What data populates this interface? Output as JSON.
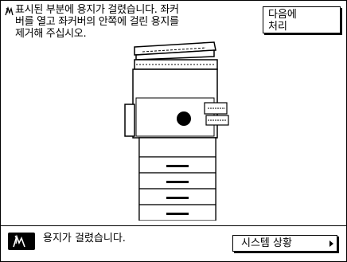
{
  "message": {
    "icon": "paper-jam-icon",
    "text": "표시된 부분에 용지가 걸렸습니다. 좌커\n버를 열고 좌커버의 안쪽에 걸린 용지를\n제거해 주십시오."
  },
  "buttons": {
    "handle_later_label": "다음에\n처리",
    "system_status_label": "시스템 상황"
  },
  "status_bar": {
    "icon": "paper-jam-icon",
    "text": "용지가 걸렸습니다."
  },
  "illustration": {
    "icon": "copier-machine-icon",
    "jam_indicator": "jam-location-marker"
  }
}
